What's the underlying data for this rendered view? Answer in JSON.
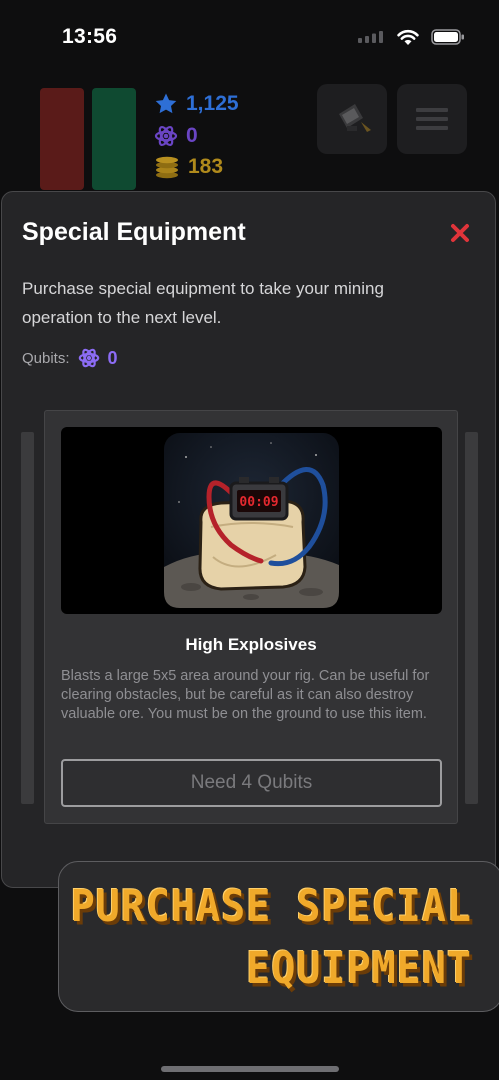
{
  "status_bar": {
    "time": "13:56"
  },
  "hud": {
    "stars": "1,125",
    "qubits": "0",
    "coins": "183",
    "star_color": "#2e6fd6",
    "qubit_color": "#7a4fd8",
    "coin_color": "#c79a1e"
  },
  "modal": {
    "title": "Special Equipment",
    "description": "Purchase special equipment to take your mining operation to the next level.",
    "qubits_label": "Qubits:",
    "qubits_value": "0",
    "close_color": "#e0343a"
  },
  "item": {
    "image_alt": "High explosives: a sandbag charge with a digital timer and red and blue wires",
    "timer_text": "00:09",
    "title": "High Explosives",
    "description": "Blasts a large 5x5 area around your rig. Can be useful for clearing obstacles, but be careful as it can also destroy valuable ore. You must be on the ground to use this item.",
    "button_label": "Need 4 Qubits"
  },
  "promo": {
    "line1": "PURCHASE SPECIAL",
    "line2": "EQUIPMENT",
    "color": "#f0a92a"
  }
}
